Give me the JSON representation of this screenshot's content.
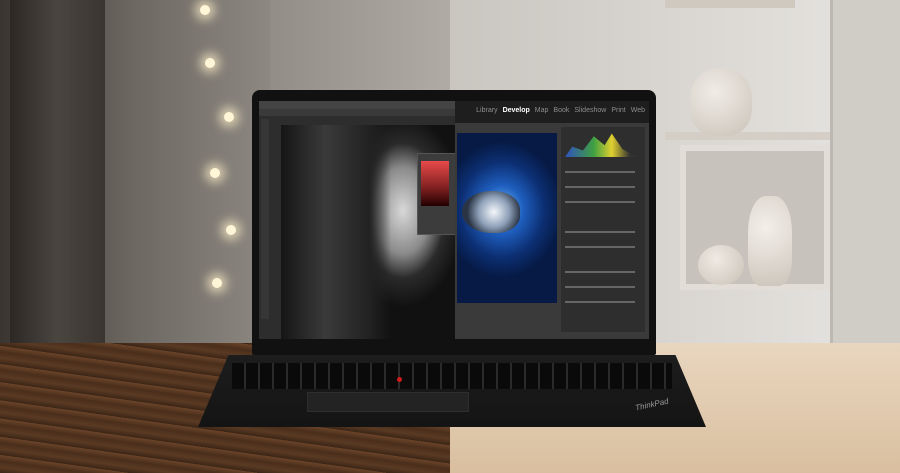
{
  "scene": {
    "description_left_half": "dim wooden table and dark room",
    "description_right_half": "bright light wooden table and shelves",
    "split": "vertical"
  },
  "laptop": {
    "screen": {
      "lightroom_nav": {
        "items": [
          "Library",
          "Develop",
          "Map",
          "Book",
          "Slideshow",
          "Print",
          "Web"
        ],
        "active": "Develop"
      }
    },
    "brand_logo": "ThinkPad"
  },
  "colors": {
    "trackpoint": "#d21b1b",
    "blue_car": "#1f5fbf"
  }
}
